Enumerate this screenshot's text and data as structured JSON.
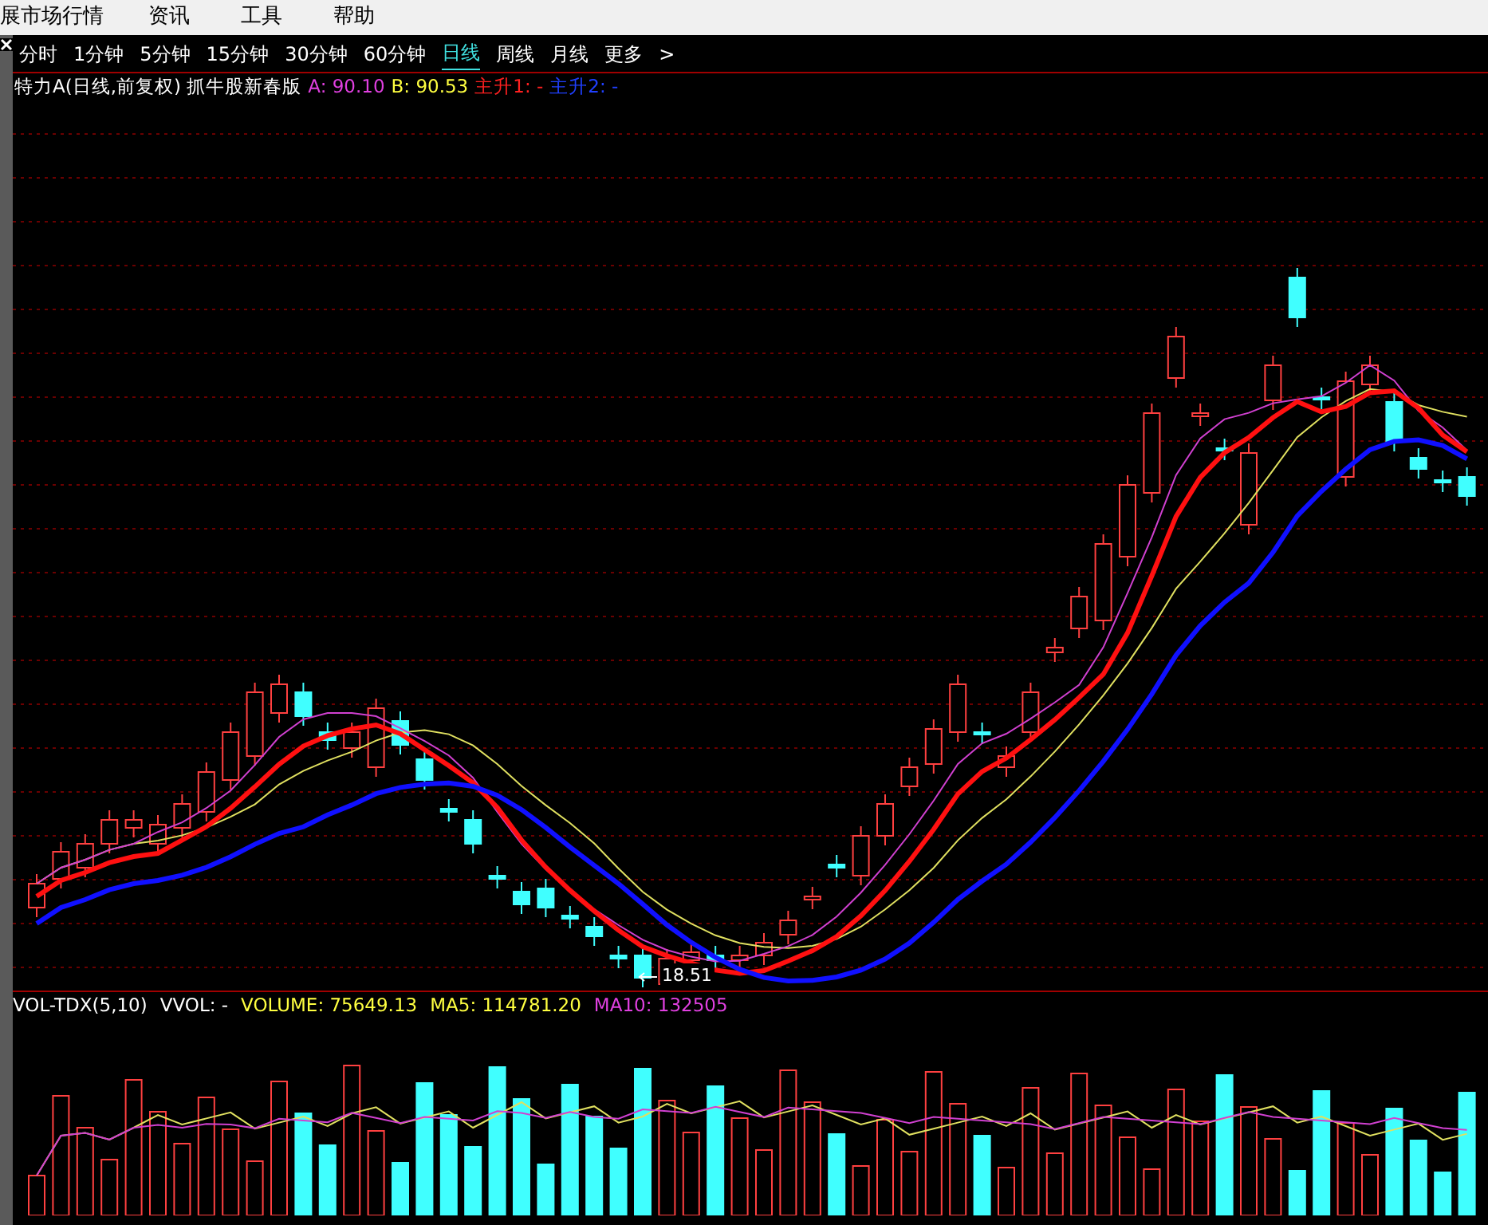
{
  "menu": [
    "展市场行情",
    "资讯",
    "工具",
    "帮助"
  ],
  "tabs": [
    {
      "label": "分时",
      "selected": false
    },
    {
      "label": "1分钟",
      "selected": false
    },
    {
      "label": "5分钟",
      "selected": false
    },
    {
      "label": "15分钟",
      "selected": false
    },
    {
      "label": "30分钟",
      "selected": false
    },
    {
      "label": "60分钟",
      "selected": false
    },
    {
      "label": "日线",
      "selected": true
    },
    {
      "label": "周线",
      "selected": false
    },
    {
      "label": "月线",
      "selected": false
    },
    {
      "label": "更多",
      "selected": false
    }
  ],
  "more_arrow": ">",
  "price_panel": {
    "title": "特力A(日线,前复权) 抓牛股新春版",
    "legend": [
      {
        "text": "A: 90.10",
        "color": "#e040e0"
      },
      {
        "text": "B: 90.53",
        "color": "#ffff40"
      },
      {
        "text": "主升1: -",
        "color": "#ff2020"
      },
      {
        "text": "主升2: -",
        "color": "#2040ff"
      }
    ],
    "low_marker": "18.51"
  },
  "volume_panel": {
    "legend": [
      {
        "text": "VOL-TDX(5,10)"
      },
      {
        "text": "VVOL: -"
      },
      {
        "text": "VOLUME: 75649.13",
        "color": "#ffff40"
      },
      {
        "text": "MA5: 114781.20",
        "color": "#ffff40"
      },
      {
        "text": "MA10: 132505",
        "color": "#e040e0"
      }
    ]
  }
}
